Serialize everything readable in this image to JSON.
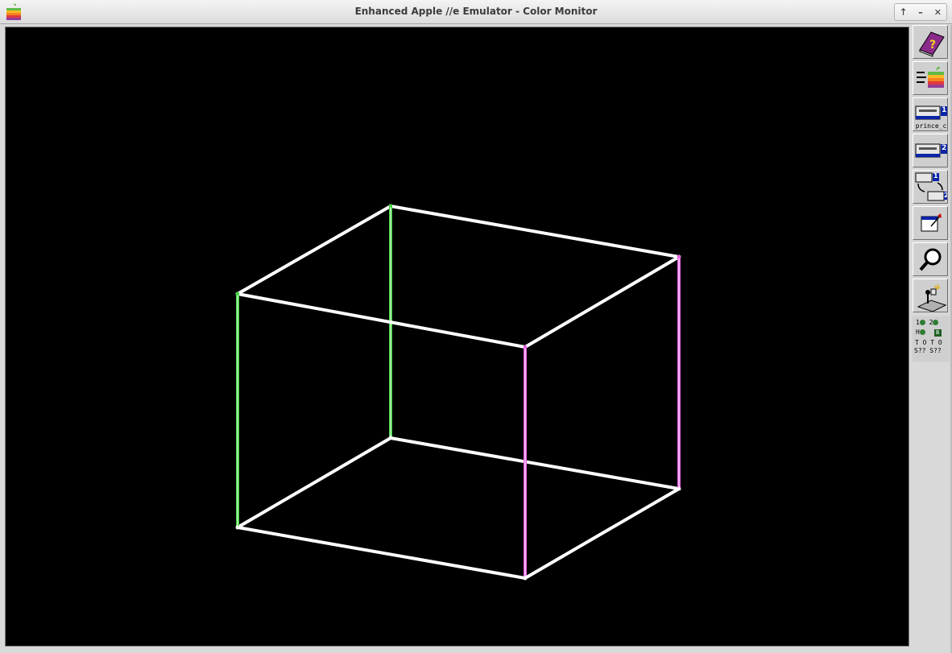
{
  "window": {
    "title": "Enhanced Apple //e Emulator - Color Monitor",
    "controls": [
      "🡑",
      "–",
      "✕"
    ]
  },
  "toolbar": {
    "drive1_number": "1",
    "drive1_disk": "prince_c",
    "drive2_number": "2",
    "swap_numbers": [
      "1",
      "2"
    ]
  },
  "status": {
    "row1": [
      "1",
      "2"
    ],
    "row2": [
      "H",
      "B"
    ],
    "row3": "T O T O",
    "row4": "S?? S??"
  },
  "colors": {
    "white": "#ffffff",
    "green": "#3fd33f",
    "magenta": "#e65ce6",
    "screen": "#000000"
  }
}
